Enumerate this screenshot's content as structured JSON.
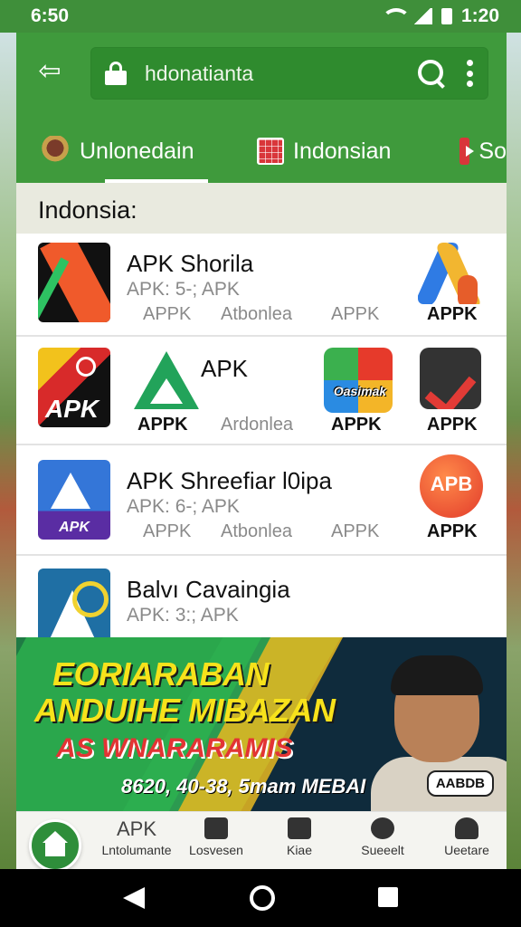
{
  "status_bar": {
    "time_left": "6:50",
    "time_right": "1:20"
  },
  "header": {
    "address": "hdonatianta",
    "tabs": [
      {
        "label": "Unlonedain",
        "icon": "eagle-emblem-icon",
        "active": true
      },
      {
        "label": "Indonsian",
        "icon": "grid-flag-icon",
        "active": false
      },
      {
        "label": "So",
        "icon": "play-icon",
        "active": false
      }
    ]
  },
  "section": {
    "title": "Indonsia:"
  },
  "list": {
    "rows": [
      {
        "title": "APK Shorila",
        "subtitle": "APK: 5-; APK",
        "labels": [
          "APPK",
          "Atbonlea",
          "APPK"
        ],
        "right_label": "APPK"
      },
      {
        "title": "APK",
        "icon_text_left": "APK",
        "icon_text_colorful": "Oasimak",
        "labels": [
          "APPK",
          "Ardonlea",
          "APPK",
          "APPK"
        ]
      },
      {
        "title": "APK Shreefiar l0ipa",
        "subtitle": "APK: 6-; APK",
        "icon_text": "APK",
        "right_icon_text": "APB",
        "labels": [
          "APPK",
          "Atbonlea",
          "APPK"
        ],
        "right_label": "APPK"
      },
      {
        "title": "Balvı Cavaingia",
        "subtitle": "APK: 3:; APK"
      }
    ]
  },
  "banner": {
    "line1": "EORIARABAN",
    "line2": "ANDUIHE MIBAZAN",
    "line3": "AS WNARARAMIS",
    "line4": "8620, 40-38, 5mam MEBAI",
    "badge": "AABDB"
  },
  "bottom_nav": {
    "home_label": "APK",
    "items": [
      {
        "label": "Lntolumante",
        "icon": "home-icon"
      },
      {
        "label": "Losvesen",
        "icon": "building-icon"
      },
      {
        "label": "Kiae",
        "icon": "message-icon"
      },
      {
        "label": "Sueeelt",
        "icon": "close-circle-icon"
      },
      {
        "label": "Ueetare",
        "icon": "person-icon"
      }
    ]
  },
  "colors": {
    "brand_green": "#3f9a3c",
    "accent_yellow": "#f7e21b",
    "accent_red": "#e23434"
  }
}
